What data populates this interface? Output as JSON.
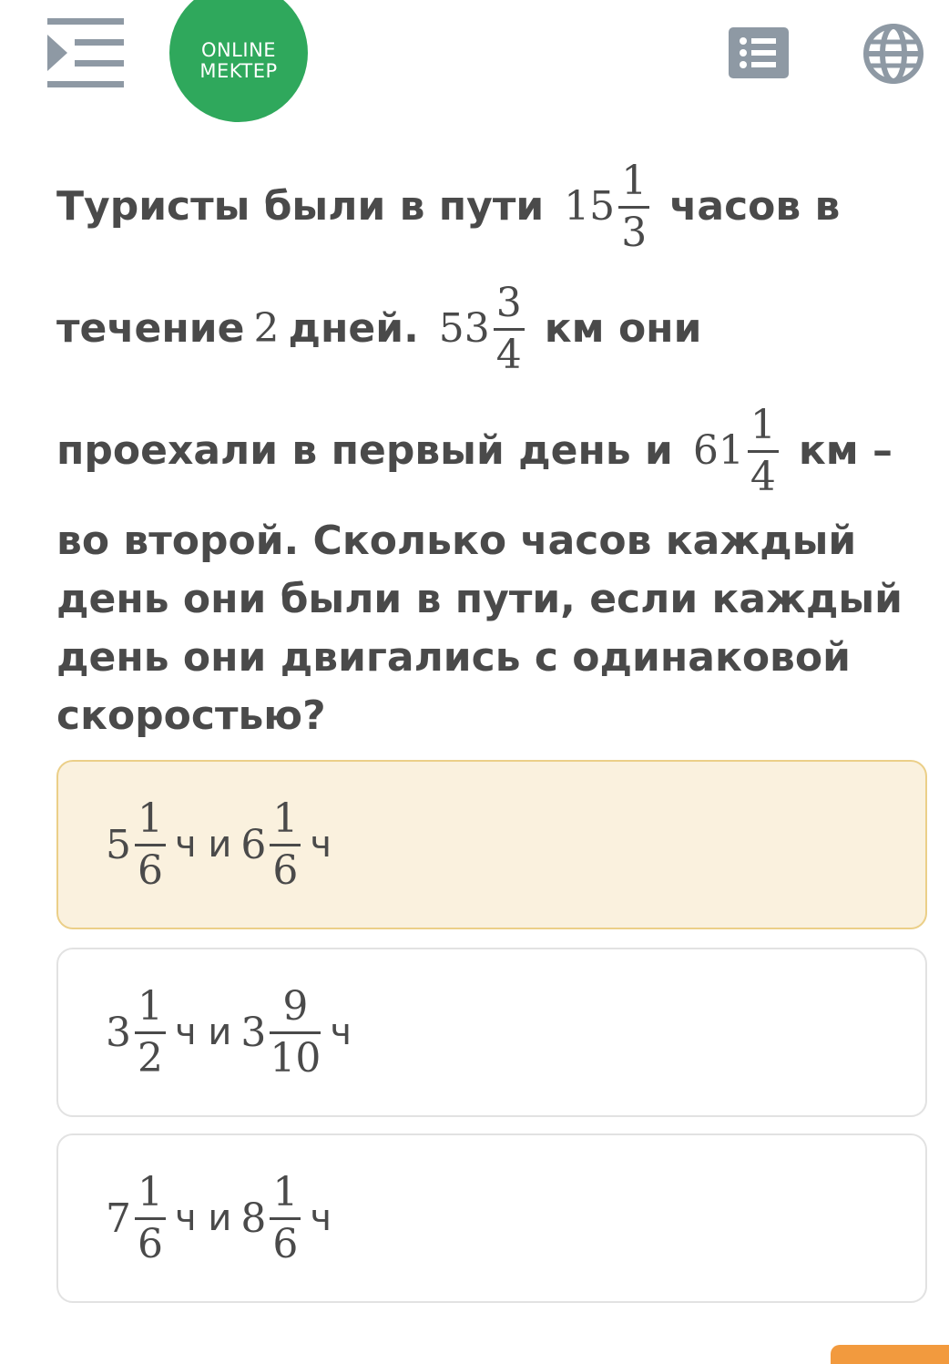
{
  "header": {
    "logo_line1": "ONLINE",
    "logo_line2": "MEKTEP",
    "brand_color": "#2fa85c",
    "icons": [
      "menu-collapse-icon",
      "list-icon",
      "globe-icon"
    ]
  },
  "question": {
    "line1_text": "Туристы были в пути",
    "line1_value": {
      "whole": "15",
      "num": "1",
      "den": "3"
    },
    "line1_tail": "часов в",
    "line2_text": "течение",
    "line2_days": "2",
    "line2_days_word": "дней.",
    "line2_value": {
      "whole": "53",
      "num": "3",
      "den": "4"
    },
    "line2_tail": "км они",
    "line3_text": "проехали в первый день и",
    "line3_value": {
      "whole": "61",
      "num": "1",
      "den": "4"
    },
    "line3_tail": "км –",
    "line4": "во второй. Сколько часов каждый",
    "line5": "день они были в пути, если каждый",
    "line6": "день они двигались с одинаковой",
    "line7": "скоростью?"
  },
  "options": [
    {
      "a": {
        "whole": "5",
        "num": "1",
        "den": "6"
      },
      "b": {
        "whole": "6",
        "num": "1",
        "den": "6"
      },
      "unit": "ч",
      "joiner": "ч и",
      "selected": true
    },
    {
      "a": {
        "whole": "3",
        "num": "1",
        "den": "2"
      },
      "b": {
        "whole": "3",
        "num": "9",
        "den": "10"
      },
      "unit": "ч",
      "joiner": "ч и",
      "selected": false
    },
    {
      "a": {
        "whole": "7",
        "num": "1",
        "den": "6"
      },
      "b": {
        "whole": "8",
        "num": "1",
        "den": "6"
      },
      "unit": "ч",
      "joiner": "ч и",
      "selected": false
    }
  ],
  "colors": {
    "selected_bg": "#faf1de",
    "selected_border": "#ebcf88",
    "accent_orange": "#f29a3e",
    "icon_gray": "#8e99a4"
  }
}
